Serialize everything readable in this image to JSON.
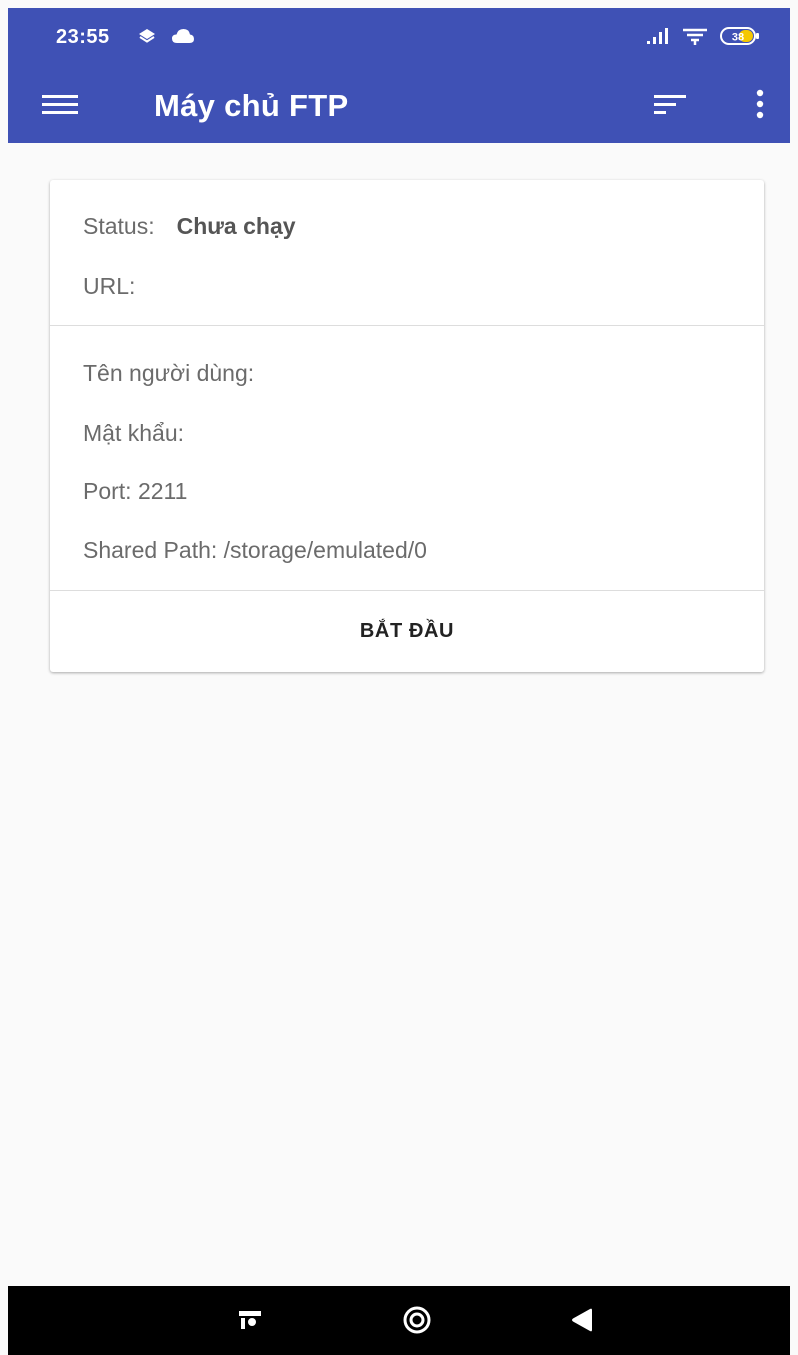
{
  "status_bar": {
    "time": "23:55",
    "battery_level": "38"
  },
  "toolbar": {
    "title": "Máy chủ FTP",
    "color": "#3f51b5"
  },
  "card": {
    "status_label": "Status:",
    "status_value": "Chưa chạy",
    "url_label": "URL:",
    "username_label": "Tên người dùng:",
    "password_label": "Mật khẩu:",
    "port_text": "Port: 2211",
    "shared_path_text": "Shared Path: /storage/emulated/0",
    "start_button_label": "BẮT ĐẦU"
  },
  "icons": {
    "menu": "menu-icon",
    "sort": "sort-icon",
    "more": "more-vert-icon",
    "signal": "signal-icon",
    "wifi": "wifi-icon",
    "battery": "battery-icon",
    "nav_recents": "recents-icon",
    "nav_home": "home-icon",
    "nav_back": "back-icon"
  }
}
